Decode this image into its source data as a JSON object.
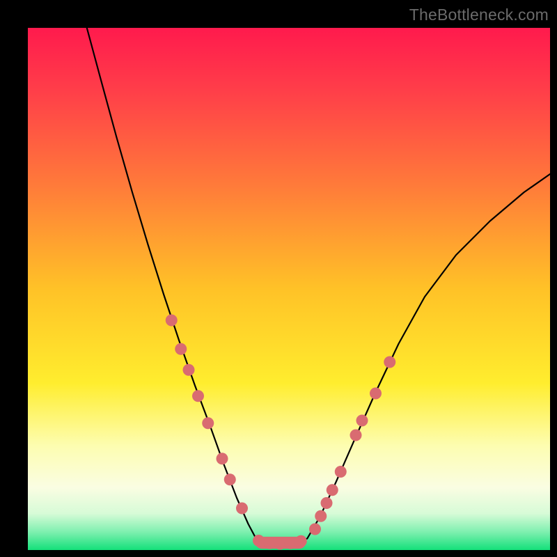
{
  "watermark": "TheBottleneck.com",
  "chart_data": {
    "type": "line",
    "title": "",
    "xlabel": "",
    "ylabel": "",
    "xlim": [
      0,
      100
    ],
    "ylim": [
      0,
      100
    ],
    "gradient_stops": [
      {
        "offset": 0.0,
        "color": "#ff1a4d"
      },
      {
        "offset": 0.12,
        "color": "#ff3e49"
      },
      {
        "offset": 0.3,
        "color": "#ff7a3a"
      },
      {
        "offset": 0.5,
        "color": "#ffc227"
      },
      {
        "offset": 0.68,
        "color": "#ffed2e"
      },
      {
        "offset": 0.8,
        "color": "#fdfdb0"
      },
      {
        "offset": 0.88,
        "color": "#fafde2"
      },
      {
        "offset": 0.93,
        "color": "#d7fbd7"
      },
      {
        "offset": 0.965,
        "color": "#7ff0b0"
      },
      {
        "offset": 1.0,
        "color": "#14e07a"
      }
    ],
    "series": [
      {
        "name": "left-arm",
        "x": [
          11.3,
          14.0,
          17.0,
          20.0,
          23.0,
          26.0,
          29.0,
          32.0,
          35.0,
          37.5,
          40.0,
          42.2,
          43.8
        ],
        "y": [
          100.0,
          90.0,
          79.0,
          68.5,
          58.5,
          49.0,
          40.0,
          31.5,
          23.5,
          16.5,
          10.0,
          5.0,
          2.0
        ]
      },
      {
        "name": "flat-bottom",
        "x": [
          43.8,
          46.0,
          48.0,
          50.0,
          52.0,
          53.5
        ],
        "y": [
          2.0,
          1.3,
          1.2,
          1.3,
          1.6,
          2.2
        ]
      },
      {
        "name": "right-arm",
        "x": [
          53.5,
          56.0,
          59.0,
          62.5,
          66.5,
          71.0,
          76.0,
          82.0,
          88.5,
          95.0,
          100.0
        ],
        "y": [
          2.2,
          6.5,
          13.0,
          21.0,
          30.0,
          39.5,
          48.5,
          56.5,
          63.0,
          68.5,
          72.0
        ]
      }
    ],
    "markers": {
      "name": "highlight-dots",
      "color": "#d96b71",
      "radius": 8.5,
      "points": [
        {
          "x": 27.5,
          "y": 44.0
        },
        {
          "x": 29.3,
          "y": 38.5
        },
        {
          "x": 30.8,
          "y": 34.5
        },
        {
          "x": 32.6,
          "y": 29.5
        },
        {
          "x": 34.5,
          "y": 24.3
        },
        {
          "x": 37.2,
          "y": 17.5
        },
        {
          "x": 38.7,
          "y": 13.5
        },
        {
          "x": 41.0,
          "y": 8.0
        },
        {
          "x": 44.2,
          "y": 1.8
        },
        {
          "x": 46.3,
          "y": 1.3
        },
        {
          "x": 48.3,
          "y": 1.2
        },
        {
          "x": 50.3,
          "y": 1.3
        },
        {
          "x": 52.3,
          "y": 1.7
        },
        {
          "x": 55.0,
          "y": 4.0
        },
        {
          "x": 56.1,
          "y": 6.5
        },
        {
          "x": 57.2,
          "y": 9.0
        },
        {
          "x": 58.3,
          "y": 11.5
        },
        {
          "x": 59.9,
          "y": 15.0
        },
        {
          "x": 62.8,
          "y": 22.0
        },
        {
          "x": 64.0,
          "y": 24.8
        },
        {
          "x": 66.6,
          "y": 30.0
        },
        {
          "x": 69.3,
          "y": 36.0
        }
      ]
    },
    "bottom_capsule": {
      "name": "flat-min-bar",
      "color": "#d96b71",
      "x_start": 43.6,
      "x_end": 53.2,
      "y": 1.4,
      "height_pct": 2.3
    }
  }
}
